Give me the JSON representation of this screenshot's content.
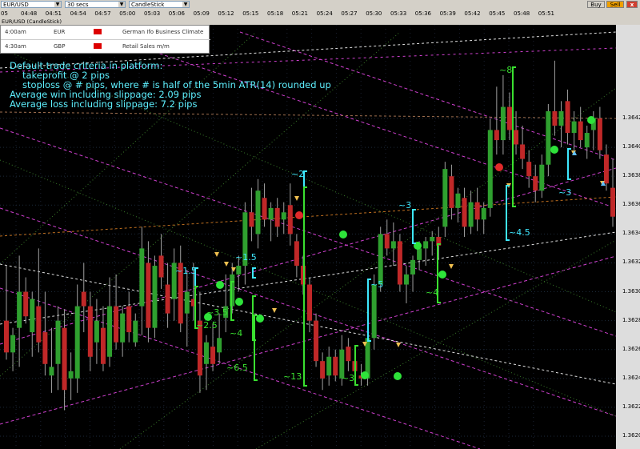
{
  "toolbar": {
    "symbol": "EUR/USD",
    "interval": "30 secs",
    "chart_type": "CandleStick",
    "buy_label": "Buy",
    "sell_label": "Sell",
    "close_label": "x"
  },
  "time_labels": [
    "04:48",
    "04:51",
    "04:54",
    "04:57",
    "05:00",
    "05:03",
    "05:06",
    "05:09",
    "05:12",
    "05:15",
    "05:18",
    "05:21",
    "05:24",
    "05:27",
    "05:30",
    "05:33",
    "05:36",
    "05:39",
    "05:42",
    "05:45",
    "05:48",
    "05:51"
  ],
  "time_prefix": "05",
  "chart_title": "EUR/USD (CandleStick)",
  "news": [
    {
      "time": "4:00am",
      "currency": "EUR",
      "event": "German Ifo Business Climate"
    },
    {
      "time": "4:30am",
      "currency": "GBP",
      "event": "Retail Sales m/m"
    }
  ],
  "notes": {
    "line1": "Default trade criteria in platform:",
    "line2": "takeprofit @ 2 pips",
    "line3": "stoploss @ # pips, where # is half of the 5min ATR(14) rounded up",
    "line4": "Average win including slippage: 2.09 pips",
    "line5": "Average loss including slippage: 7.2 pips"
  },
  "chart_data": {
    "type": "candlestick",
    "symbol": "EUR/USD",
    "interval": "30 secs",
    "y_ticks": [
      "1.3642",
      "1.3640",
      "1.3638",
      "1.3636",
      "1.3634",
      "1.3632",
      "1.3630",
      "1.3628",
      "1.3626",
      "1.3624",
      "1.3622",
      "1.3620"
    ],
    "ylim": [
      1.36185,
      1.36495
    ],
    "candles": [
      {
        "o": 1.3628,
        "h": 1.36318,
        "l": 1.36253,
        "c": 1.36258
      },
      {
        "o": 1.36258,
        "h": 1.36275,
        "l": 1.36245,
        "c": 1.3627
      },
      {
        "o": 1.36275,
        "h": 1.36325,
        "l": 1.36248,
        "c": 1.363
      },
      {
        "o": 1.363,
        "h": 1.3631,
        "l": 1.36278,
        "c": 1.36283
      },
      {
        "o": 1.36272,
        "h": 1.363,
        "l": 1.36255,
        "c": 1.36295
      },
      {
        "o": 1.3629,
        "h": 1.3633,
        "l": 1.36258,
        "c": 1.36265
      },
      {
        "o": 1.36272,
        "h": 1.363,
        "l": 1.36242,
        "c": 1.3625
      },
      {
        "o": 1.36242,
        "h": 1.36275,
        "l": 1.3623,
        "c": 1.36248
      },
      {
        "o": 1.3625,
        "h": 1.3629,
        "l": 1.36232,
        "c": 1.3628
      },
      {
        "o": 1.36275,
        "h": 1.36288,
        "l": 1.36218,
        "c": 1.36232
      },
      {
        "o": 1.3624,
        "h": 1.36258,
        "l": 1.36225,
        "c": 1.36245
      },
      {
        "o": 1.3624,
        "h": 1.36305,
        "l": 1.3623,
        "c": 1.3629
      },
      {
        "o": 1.363,
        "h": 1.3632,
        "l": 1.36272,
        "c": 1.3629
      },
      {
        "o": 1.3629,
        "h": 1.363,
        "l": 1.36245,
        "c": 1.36255
      },
      {
        "o": 1.36265,
        "h": 1.36295,
        "l": 1.3625,
        "c": 1.3628
      },
      {
        "o": 1.36275,
        "h": 1.3629,
        "l": 1.36245,
        "c": 1.3625
      },
      {
        "o": 1.36255,
        "h": 1.3631,
        "l": 1.36248,
        "c": 1.3629
      },
      {
        "o": 1.3629,
        "h": 1.36312,
        "l": 1.3626,
        "c": 1.36265
      },
      {
        "o": 1.36265,
        "h": 1.3629,
        "l": 1.36255,
        "c": 1.36285
      },
      {
        "o": 1.3629,
        "h": 1.363,
        "l": 1.36265,
        "c": 1.36272
      },
      {
        "o": 1.36265,
        "h": 1.36285,
        "l": 1.36262,
        "c": 1.3628
      },
      {
        "o": 1.3629,
        "h": 1.36345,
        "l": 1.3627,
        "c": 1.3633
      },
      {
        "o": 1.3632,
        "h": 1.36335,
        "l": 1.36265,
        "c": 1.36275
      },
      {
        "o": 1.36275,
        "h": 1.36325,
        "l": 1.36268,
        "c": 1.36318
      },
      {
        "o": 1.36325,
        "h": 1.3634,
        "l": 1.36302,
        "c": 1.3631
      },
      {
        "o": 1.36305,
        "h": 1.3632,
        "l": 1.36275,
        "c": 1.36285
      },
      {
        "o": 1.36295,
        "h": 1.3633,
        "l": 1.3628,
        "c": 1.3632
      },
      {
        "o": 1.3632,
        "h": 1.36332,
        "l": 1.36272,
        "c": 1.36278
      },
      {
        "o": 1.36285,
        "h": 1.36315,
        "l": 1.36262,
        "c": 1.363
      },
      {
        "o": 1.36295,
        "h": 1.3632,
        "l": 1.3628,
        "c": 1.3629
      },
      {
        "o": 1.3628,
        "h": 1.363,
        "l": 1.3623,
        "c": 1.36242
      },
      {
        "o": 1.3625,
        "h": 1.3627,
        "l": 1.36232,
        "c": 1.36265
      },
      {
        "o": 1.36262,
        "h": 1.36278,
        "l": 1.36245,
        "c": 1.3625
      },
      {
        "o": 1.36258,
        "h": 1.36285,
        "l": 1.3625,
        "c": 1.36268
      },
      {
        "o": 1.36282,
        "h": 1.36312,
        "l": 1.36272,
        "c": 1.3629
      },
      {
        "o": 1.3629,
        "h": 1.3632,
        "l": 1.36285,
        "c": 1.36312
      },
      {
        "o": 1.36312,
        "h": 1.36325,
        "l": 1.363,
        "c": 1.36318
      },
      {
        "o": 1.36318,
        "h": 1.36362,
        "l": 1.36305,
        "c": 1.36355
      },
      {
        "o": 1.36355,
        "h": 1.36372,
        "l": 1.36335,
        "c": 1.36345
      },
      {
        "o": 1.3634,
        "h": 1.36378,
        "l": 1.3633,
        "c": 1.3637
      },
      {
        "o": 1.36365,
        "h": 1.36375,
        "l": 1.36345,
        "c": 1.3635
      },
      {
        "o": 1.3635,
        "h": 1.36362,
        "l": 1.36335,
        "c": 1.36358
      },
      {
        "o": 1.36358,
        "h": 1.36365,
        "l": 1.36338,
        "c": 1.36345
      },
      {
        "o": 1.3635,
        "h": 1.36362,
        "l": 1.3634,
        "c": 1.36355
      },
      {
        "o": 1.3636,
        "h": 1.36375,
        "l": 1.36332,
        "c": 1.3634
      },
      {
        "o": 1.36335,
        "h": 1.3634,
        "l": 1.3631,
        "c": 1.36318
      },
      {
        "o": 1.36318,
        "h": 1.36325,
        "l": 1.36298,
        "c": 1.36305
      },
      {
        "o": 1.36305,
        "h": 1.3631,
        "l": 1.36272,
        "c": 1.3628
      },
      {
        "o": 1.3628,
        "h": 1.36285,
        "l": 1.36248,
        "c": 1.36252
      },
      {
        "o": 1.36252,
        "h": 1.36258,
        "l": 1.36232,
        "c": 1.3624
      },
      {
        "o": 1.36242,
        "h": 1.36262,
        "l": 1.36235,
        "c": 1.36255
      },
      {
        "o": 1.36255,
        "h": 1.3626,
        "l": 1.36238,
        "c": 1.36242
      },
      {
        "o": 1.3624,
        "h": 1.3627,
        "l": 1.36235,
        "c": 1.3626
      },
      {
        "o": 1.36262,
        "h": 1.36268,
        "l": 1.36245,
        "c": 1.36252
      },
      {
        "o": 1.36252,
        "h": 1.36262,
        "l": 1.36238,
        "c": 1.36245
      },
      {
        "o": 1.36242,
        "h": 1.3625,
        "l": 1.36235,
        "c": 1.3624
      },
      {
        "o": 1.3624,
        "h": 1.36275,
        "l": 1.36235,
        "c": 1.36268
      },
      {
        "o": 1.36268,
        "h": 1.36312,
        "l": 1.3626,
        "c": 1.36305
      },
      {
        "o": 1.36305,
        "h": 1.36345,
        "l": 1.363,
        "c": 1.3634
      },
      {
        "o": 1.3634,
        "h": 1.3635,
        "l": 1.36325,
        "c": 1.3633
      },
      {
        "o": 1.3633,
        "h": 1.36348,
        "l": 1.36318,
        "c": 1.36335
      },
      {
        "o": 1.36335,
        "h": 1.3634,
        "l": 1.363,
        "c": 1.36305
      },
      {
        "o": 1.36305,
        "h": 1.36318,
        "l": 1.36292,
        "c": 1.36312
      },
      {
        "o": 1.36312,
        "h": 1.36325,
        "l": 1.363,
        "c": 1.36322
      },
      {
        "o": 1.36322,
        "h": 1.36335,
        "l": 1.36315,
        "c": 1.3633
      },
      {
        "o": 1.3633,
        "h": 1.36338,
        "l": 1.36318,
        "c": 1.36335
      },
      {
        "o": 1.36335,
        "h": 1.36342,
        "l": 1.36325,
        "c": 1.36338
      },
      {
        "o": 1.36338,
        "h": 1.36345,
        "l": 1.36322,
        "c": 1.36332
      },
      {
        "o": 1.36345,
        "h": 1.3639,
        "l": 1.36338,
        "c": 1.36385
      },
      {
        "o": 1.3638,
        "h": 1.36388,
        "l": 1.3635,
        "c": 1.36358
      },
      {
        "o": 1.36358,
        "h": 1.36372,
        "l": 1.36348,
        "c": 1.36368
      },
      {
        "o": 1.36365,
        "h": 1.36372,
        "l": 1.36338,
        "c": 1.36345
      },
      {
        "o": 1.36345,
        "h": 1.3637,
        "l": 1.3634,
        "c": 1.36362
      },
      {
        "o": 1.36362,
        "h": 1.36372,
        "l": 1.36342,
        "c": 1.3635
      },
      {
        "o": 1.3635,
        "h": 1.36362,
        "l": 1.3634,
        "c": 1.36358
      },
      {
        "o": 1.36358,
        "h": 1.3642,
        "l": 1.36352,
        "c": 1.36412
      },
      {
        "o": 1.36412,
        "h": 1.36442,
        "l": 1.36395,
        "c": 1.36405
      },
      {
        "o": 1.36405,
        "h": 1.3645,
        "l": 1.36395,
        "c": 1.36428
      },
      {
        "o": 1.36428,
        "h": 1.36438,
        "l": 1.36405,
        "c": 1.36412
      },
      {
        "o": 1.36412,
        "h": 1.36425,
        "l": 1.36395,
        "c": 1.36402
      },
      {
        "o": 1.36402,
        "h": 1.36415,
        "l": 1.36385,
        "c": 1.36392
      },
      {
        "o": 1.3639,
        "h": 1.36398,
        "l": 1.36372,
        "c": 1.3638
      },
      {
        "o": 1.3638,
        "h": 1.36388,
        "l": 1.36362,
        "c": 1.3637
      },
      {
        "o": 1.3637,
        "h": 1.36395,
        "l": 1.36365,
        "c": 1.36388
      },
      {
        "o": 1.36388,
        "h": 1.3643,
        "l": 1.3638,
        "c": 1.36425
      },
      {
        "o": 1.36425,
        "h": 1.3646,
        "l": 1.36408,
        "c": 1.36415
      },
      {
        "o": 1.36415,
        "h": 1.36432,
        "l": 1.364,
        "c": 1.36425
      },
      {
        "o": 1.36432,
        "h": 1.3644,
        "l": 1.36402,
        "c": 1.3641
      },
      {
        "o": 1.3641,
        "h": 1.36425,
        "l": 1.36398,
        "c": 1.36418
      },
      {
        "o": 1.36418,
        "h": 1.36428,
        "l": 1.364,
        "c": 1.36405
      },
      {
        "o": 1.364,
        "h": 1.36415,
        "l": 1.36392,
        "c": 1.3641
      },
      {
        "o": 1.36412,
        "h": 1.36425,
        "l": 1.36398,
        "c": 1.3642
      },
      {
        "o": 1.3642,
        "h": 1.36428,
        "l": 1.36392,
        "c": 1.36398
      },
      {
        "o": 1.36395,
        "h": 1.36402,
        "l": 1.3637,
        "c": 1.36375
      },
      {
        "o": 1.36372,
        "h": 1.36392,
        "l": 1.36345,
        "c": 1.36352
      }
    ],
    "annotations": [
      {
        "text": "~1.5",
        "color": "cyan"
      },
      {
        "text": "~2.5",
        "color": "green"
      },
      {
        "text": "~3.5",
        "color": "green"
      },
      {
        "text": "~1.5",
        "color": "cyan"
      },
      {
        "text": "~4",
        "color": "green"
      },
      {
        "text": "~6.5",
        "color": "green"
      },
      {
        "text": "~2",
        "color": "cyan"
      },
      {
        "text": "~13",
        "color": "green"
      },
      {
        "text": "~5",
        "color": "cyan"
      },
      {
        "text": "~3",
        "color": "green"
      },
      {
        "text": "~3",
        "color": "cyan"
      },
      {
        "text": "~4",
        "color": "green"
      },
      {
        "text": "~8",
        "color": "green"
      },
      {
        "text": "~4.5",
        "color": "cyan"
      },
      {
        "text": "~3",
        "color": "cyan"
      }
    ],
    "grid": true
  }
}
